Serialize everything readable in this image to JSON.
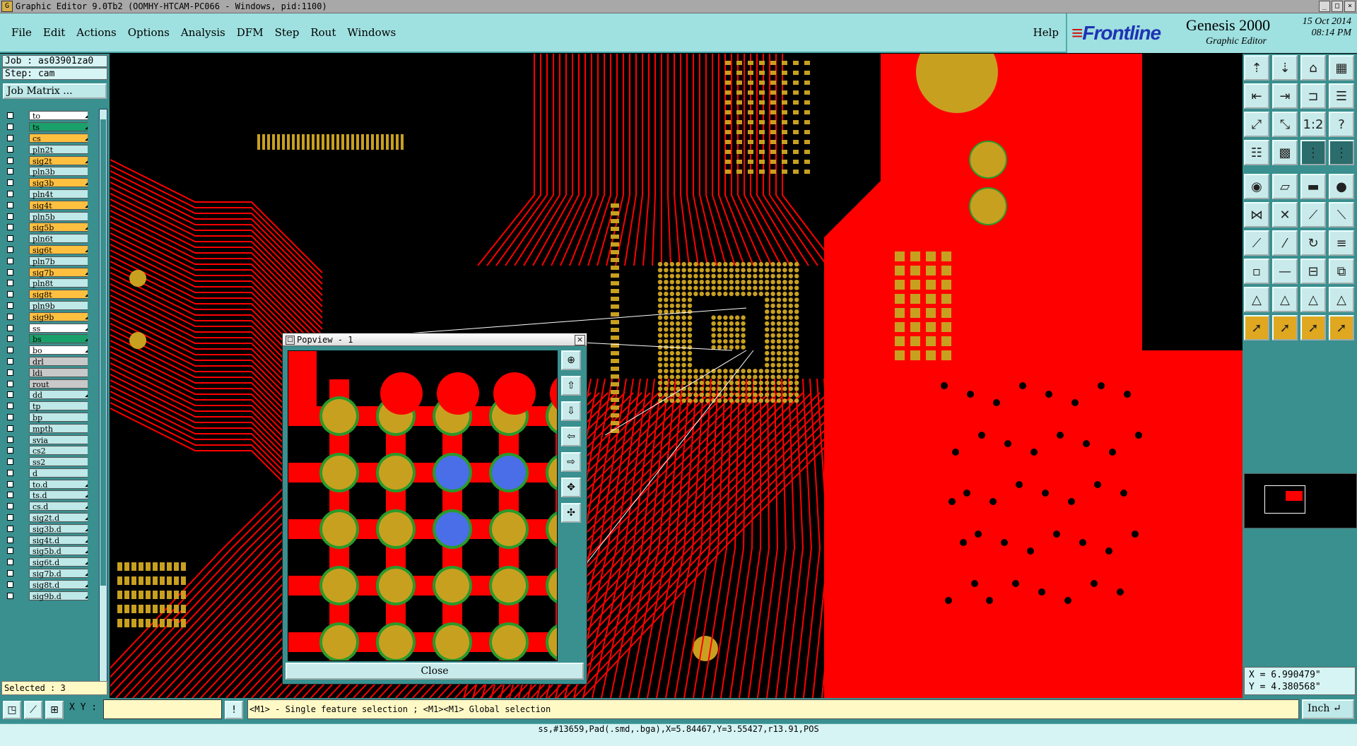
{
  "window": {
    "title": "Graphic Editor 9.0Tb2 (OOMHY-HTCAM-PC066 - Windows, pid:1100)"
  },
  "menu": {
    "items": [
      "File",
      "Edit",
      "Actions",
      "Options",
      "Analysis",
      "DFM",
      "Step",
      "Rout",
      "Windows"
    ],
    "help": "Help"
  },
  "brand": {
    "logo": "Frontline",
    "product": "Genesis 2000",
    "subtitle": "Graphic Editor",
    "date": "15 Oct 2014",
    "time": "08:14 PM"
  },
  "job": {
    "job_label": "Job : as03901za0",
    "step_label": "Step: cam",
    "matrix_button": "Job Matrix ..."
  },
  "layers": [
    {
      "name": "to",
      "color": "#ffffff",
      "arrow": true
    },
    {
      "name": "ts",
      "color": "#1aa06a",
      "arrow": true
    },
    {
      "name": "cs",
      "color": "#ffc040",
      "arrow": true
    },
    {
      "name": "pln2t",
      "color": "#bfe8e8",
      "arrow": false
    },
    {
      "name": "sig2t",
      "color": "#ffc040",
      "arrow": true
    },
    {
      "name": "pln3b",
      "color": "#bfe8e8",
      "arrow": false
    },
    {
      "name": "sig3b",
      "color": "#ffc040",
      "arrow": true
    },
    {
      "name": "pln4t",
      "color": "#bfe8e8",
      "arrow": false
    },
    {
      "name": "sig4t",
      "color": "#ffc040",
      "arrow": true
    },
    {
      "name": "pln5b",
      "color": "#bfe8e8",
      "arrow": false
    },
    {
      "name": "sig5b",
      "color": "#ffc040",
      "arrow": true
    },
    {
      "name": "pln6t",
      "color": "#bfe8e8",
      "arrow": false
    },
    {
      "name": "sig6t",
      "color": "#ffc040",
      "arrow": true
    },
    {
      "name": "pln7b",
      "color": "#bfe8e8",
      "arrow": false
    },
    {
      "name": "sig7b",
      "color": "#ffc040",
      "arrow": true
    },
    {
      "name": "pln8t",
      "color": "#bfe8e8",
      "arrow": false
    },
    {
      "name": "sig8t",
      "color": "#ffc040",
      "arrow": true
    },
    {
      "name": "pln9b",
      "color": "#bfe8e8",
      "arrow": false
    },
    {
      "name": "sig9b",
      "color": "#ffc040",
      "arrow": true
    },
    {
      "name": "ss",
      "color": "#ffffff",
      "arrow": true
    },
    {
      "name": "bs",
      "color": "#1aa06a",
      "arrow": true
    },
    {
      "name": "bo",
      "color": "#ffffff",
      "arrow": true
    },
    {
      "name": "drl",
      "color": "#c8c8c8",
      "arrow": false
    },
    {
      "name": "ldi",
      "color": "#c8c8c8",
      "arrow": false
    },
    {
      "name": "rout",
      "color": "#c8c8c8",
      "arrow": false
    },
    {
      "name": "dd",
      "color": "#bfe8e8",
      "arrow": true
    },
    {
      "name": "tp",
      "color": "#bfe8e8",
      "arrow": false
    },
    {
      "name": "bp",
      "color": "#bfe8e8",
      "arrow": false
    },
    {
      "name": "mpth",
      "color": "#bfe8e8",
      "arrow": false
    },
    {
      "name": "svia",
      "color": "#bfe8e8",
      "arrow": false
    },
    {
      "name": "cs2",
      "color": "#bfe8e8",
      "arrow": false
    },
    {
      "name": "ss2",
      "color": "#bfe8e8",
      "arrow": false
    },
    {
      "name": "d",
      "color": "#bfe8e8",
      "arrow": false
    },
    {
      "name": "to.d",
      "color": "#bfe8e8",
      "arrow": true
    },
    {
      "name": "ts.d",
      "color": "#bfe8e8",
      "arrow": true
    },
    {
      "name": "cs.d",
      "color": "#bfe8e8",
      "arrow": true
    },
    {
      "name": "sig2t.d",
      "color": "#bfe8e8",
      "arrow": true
    },
    {
      "name": "sig3b.d",
      "color": "#bfe8e8",
      "arrow": true
    },
    {
      "name": "sig4t.d",
      "color": "#bfe8e8",
      "arrow": true
    },
    {
      "name": "sig5b.d",
      "color": "#bfe8e8",
      "arrow": true
    },
    {
      "name": "sig6t.d",
      "color": "#bfe8e8",
      "arrow": true
    },
    {
      "name": "sig7b.d",
      "color": "#bfe8e8",
      "arrow": true
    },
    {
      "name": "sig8t.d",
      "color": "#bfe8e8",
      "arrow": true
    },
    {
      "name": "sig9b.d",
      "color": "#bfe8e8",
      "arrow": true
    }
  ],
  "selected": "Selected : 3",
  "popview": {
    "title": "Popview - 1",
    "close_label": "Close"
  },
  "coords": {
    "x": "X = 6.990479\"",
    "y": "Y = 4.380568\""
  },
  "bottom": {
    "xy_label": "X Y :",
    "xy_value": "",
    "prompt": "<M1> - Single feature selection ; <M1><M1> Global selection",
    "unit": "Inch"
  },
  "status": "ss,#13659,Pad(.smd,.bga),X=5.84467,Y=3.55427,r13.91,POS",
  "colors": {
    "board_copper": "#ff0000",
    "pad": "#c8a020",
    "mask": "#2a9a2a",
    "selected": "#4a6ee8",
    "panel": "#3a8f8f",
    "menu": "#9fe0e0"
  }
}
